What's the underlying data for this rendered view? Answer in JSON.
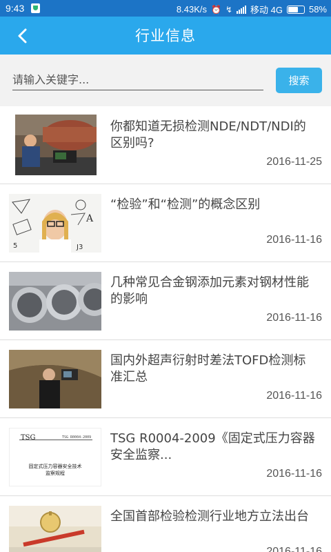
{
  "status_bar": {
    "time": "9:43",
    "net_speed": "8.43K/s",
    "carrier": "移动 4G",
    "battery": "58%"
  },
  "header": {
    "title": "行业信息"
  },
  "search": {
    "placeholder": "请输入关键字...",
    "value": "",
    "button_label": "搜索"
  },
  "news": [
    {
      "title": "你都知道无损检测NDE/NDT/NDI的区别吗?",
      "date": "2016-11-25"
    },
    {
      "title": "“检验”和“检测”的概念区别",
      "date": "2016-11-16"
    },
    {
      "title": "几种常见合金钢添加元素对钢材性能的影响",
      "date": "2016-11-16"
    },
    {
      "title": "国内外超声衍射时差法TOFD检测标准汇总",
      "date": "2016-11-16"
    },
    {
      "title": "TSG R0004-2009《固定式压力容器安全监察...",
      "date": "2016-11-16"
    },
    {
      "title": "全国首部检验检测行业地方立法出台",
      "date": "2016-11-16"
    }
  ],
  "thumb_doc": {
    "line1": "TSG",
    "line2": "TSG R0004-2009",
    "line3": "固定式压力容器安全技术",
    "line4": "监察规程"
  },
  "colors": {
    "status_bar": "#1c74c6",
    "header": "#2aa8ec",
    "search_button": "#3ab2ea"
  }
}
